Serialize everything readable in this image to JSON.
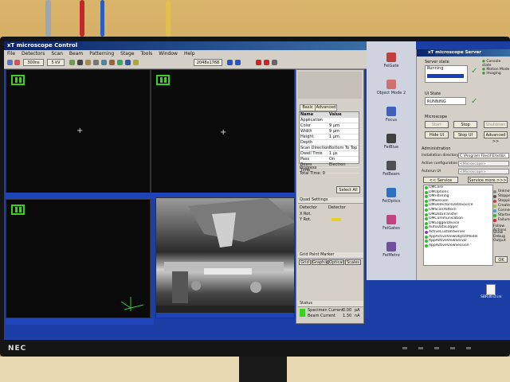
{
  "window": {
    "title": "xT microscope Control"
  },
  "menu": [
    "File",
    "Detectors",
    "Scan",
    "Beam",
    "Patterning",
    "Stage",
    "Tools",
    "Window",
    "Help"
  ],
  "toolbar": {
    "scan_speed": "300ns",
    "dwell": "5 kV",
    "hfw": "2048x1768"
  },
  "quads": {
    "q1_status": "",
    "q3_status": "",
    "sem_status": "",
    "footer_left": ""
  },
  "side_panel": {
    "tab_basic": "Basic",
    "tab_advanced": "Advanced",
    "grid_header": [
      "Name",
      "Value"
    ],
    "grid_rows": [
      [
        "Application",
        ""
      ],
      [
        "Color",
        "9 µm"
      ],
      [
        "Width",
        "9 µm"
      ],
      [
        "Height",
        "1 µm"
      ],
      [
        "Depth",
        ""
      ],
      [
        "Scan Direction",
        "Bottom To Top"
      ],
      [
        "Dwell Time",
        "1 µs"
      ],
      [
        "Pass",
        "On"
      ],
      [
        "Beam",
        "Electron"
      ],
      [
        "Time",
        ""
      ]
    ],
    "progress_label": "Progress",
    "total_time": "Total Time: 0",
    "select_all": "Select All",
    "quad_section": "Quad Settings",
    "detector_label": "Detector",
    "detector_value": "Detector",
    "x_rot": "X Rot.",
    "y_rot": "Y Rot.",
    "grid_section": "Grid Point Marker",
    "tab_grid": "Grid",
    "tab_graphic": "Graphic",
    "tab_optical": "Optical",
    "tab_scales": "Scales",
    "status_section": "Status",
    "specimen_current": "Specimen Current",
    "beam_current": "Beam Current",
    "specimen_current_value": "0.00",
    "beam_current_value": "1.30",
    "specimen_unit": "pA",
    "beam_unit": "nA"
  },
  "sidebar": [
    {
      "label": "FeiGate"
    },
    {
      "label": "Object Mode 2"
    },
    {
      "label": "Focus"
    },
    {
      "label": "FeiBlue"
    },
    {
      "label": "FeiBeam"
    },
    {
      "label": "FeiOptics"
    },
    {
      "label": "FeiGates"
    },
    {
      "label": "FeiMetro"
    }
  ],
  "server": {
    "title": "xT microscope Server",
    "server_state_label": "Server state",
    "server_state": "Running",
    "status_items": [
      "Console state",
      "Motion Mode",
      "Imaging"
    ],
    "ui_state_label": "UI State",
    "ui_state": "RUNNING",
    "microscope_label": "Microscope",
    "btn_start": "Start",
    "btn_stop": "Stop",
    "btn_shutdown": "Shutdown",
    "btn_hide": "Hide UI",
    "btn_stop_ui": "Stop UI",
    "btn_advanced": "Advanced >>",
    "admin_label": "Administration",
    "install_dir_label": "Installation directory",
    "install_dir": "C:\\Program Files\\FEI\\xtlib\\",
    "active_config_label": "Active configuration",
    "active_config": "<Microscope>",
    "autorun_label": "Autorun UI",
    "autorun_value": "<Microscope>",
    "service_tools": "<< Service tools",
    "service_more": "Service more >>>",
    "tree": [
      "OMCore",
      "OMOptions",
      "OMFiltering",
      "OMSession",
      "OMDetectorsDataSource",
      "OMScanPattern",
      "OMDataTransfer",
      "OMCommunication",
      "OMLoggerDevice",
      "AutoDataLogger",
      "ActiveCustomServer",
      "AppActiveViewObjectModel",
      "AppActiveViewServer",
      "AppActiveViewSession"
    ],
    "legend": [
      {
        "label": "Unknown",
        "color": "#888888"
      },
      {
        "label": "Stopped",
        "color": "#555555"
      },
      {
        "label": "Stopping",
        "color": "#d04040"
      },
      {
        "label": "Created",
        "color": "#a0c040"
      },
      {
        "label": "Connected",
        "color": "#40a0d0"
      },
      {
        "label": "Started",
        "color": "#2ebd2e"
      },
      {
        "label": "Failure",
        "color": "#e02020"
      }
    ],
    "follow_actions": "Follow Actions",
    "show_debug": "Show Debug Output",
    "btn_ok": "OK"
  },
  "desktop": {
    "icon_label": "SBR30.D.ini"
  },
  "monitor": {
    "brand": "NEC"
  }
}
